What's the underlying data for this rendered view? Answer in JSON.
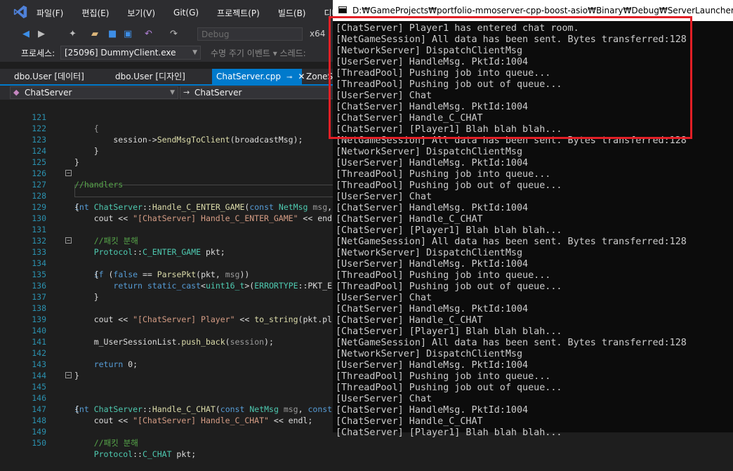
{
  "menu": {
    "items": [
      "파일(F)",
      "편집(E)",
      "보기(V)",
      "Git(G)",
      "프로젝트(P)",
      "빌드(B)",
      "디버그"
    ]
  },
  "toolbar": {
    "configuration": "Debug",
    "platform": "x64"
  },
  "process": {
    "label": "프로세스:",
    "value": "[25096] DummyClient.exe",
    "lifecycle_label": "수명 주기 이벤트 ▾ 스레드:"
  },
  "tabs": [
    {
      "label": "dbo.User [데이터]",
      "active": false
    },
    {
      "label": "dbo.User [디자인]",
      "active": false
    },
    {
      "label": "ChatServer.cpp",
      "active": true
    },
    {
      "label": "ZoneSe",
      "active": false
    }
  ],
  "nav": {
    "scope": "ChatServer",
    "member": "ChatServer"
  },
  "code_lines": [
    {
      "n": "121",
      "t": "        {"
    },
    {
      "n": "122",
      "t": "            session->SendMsgToClient(broadcastMsg);"
    },
    {
      "n": "123",
      "t": "        }"
    },
    {
      "n": "124",
      "t": "    }"
    },
    {
      "n": "125",
      "t": ""
    },
    {
      "n": "126",
      "t": "    //handlers"
    },
    {
      "n": "127",
      "t": "int ChatServer::Handle_C_ENTER_GAME(const NetMsg msg,"
    },
    {
      "n": "128",
      "t": "{"
    },
    {
      "n": "129",
      "t": "    cout << \"[ChatServer] Handle_C_ENTER_GAME\" << end"
    },
    {
      "n": "130",
      "t": ""
    },
    {
      "n": "131",
      "t": "    //패킷 분해"
    },
    {
      "n": "132",
      "t": "    Protocol::C_ENTER_GAME pkt;"
    },
    {
      "n": "133",
      "t": "    if (false == ParsePkt(pkt, msg))"
    },
    {
      "n": "134",
      "t": "    {"
    },
    {
      "n": "135",
      "t": "        return static_cast<uint16_t>(ERRORTYPE::PKT_E"
    },
    {
      "n": "136",
      "t": "    }"
    },
    {
      "n": "137",
      "t": ""
    },
    {
      "n": "138",
      "t": "    cout << \"[ChatServer] Player\" << to_string(pkt.pl"
    },
    {
      "n": "139",
      "t": ""
    },
    {
      "n": "140",
      "t": "    m_UserSessionList.push_back(session);"
    },
    {
      "n": "141",
      "t": ""
    },
    {
      "n": "142",
      "t": "    return 0;"
    },
    {
      "n": "143",
      "t": "}"
    },
    {
      "n": "144",
      "t": ""
    },
    {
      "n": "145",
      "t": "int ChatServer::Handle_C_CHAT(const NetMsg msg, const"
    },
    {
      "n": "146",
      "t": "{"
    },
    {
      "n": "147",
      "t": "    cout << \"[ChatServer] Handle_C_CHAT\" << endl;"
    },
    {
      "n": "148",
      "t": ""
    },
    {
      "n": "149",
      "t": "    //패킷 분해"
    },
    {
      "n": "150",
      "t": "    Protocol::C_CHAT pkt;"
    }
  ],
  "console": {
    "title": "D:₩GameProjects₩portfolio-mmoserver-cpp-boost-asio₩Binary₩Debug₩ServerLauncher.exe",
    "lines": [
      "[ChatServer] Player1 has entered chat room.",
      "[NetGameSession] All data has been sent. Bytes transferred:128",
      "[NetworkServer] DispatchClientMsg",
      "[UserServer] HandleMsg. PktId:1004",
      "[ThreadPool] Pushing job into queue...",
      "[ThreadPool] Pushing job out of queue...",
      "[UserServer] Chat",
      "[ChatServer] HandleMsg. PktId:1004",
      "[ChatServer] Handle_C_CHAT",
      "[ChatServer] [Player1] Blah blah blah...",
      "[NetGameSession] All data has been sent. Bytes transferred:128",
      "[NetworkServer] DispatchClientMsg",
      "[UserServer] HandleMsg. PktId:1004",
      "[ThreadPool] Pushing job into queue...",
      "[ThreadPool] Pushing job out of queue...",
      "[UserServer] Chat",
      "[ChatServer] HandleMsg. PktId:1004",
      "[ChatServer] Handle_C_CHAT",
      "[ChatServer] [Player1] Blah blah blah...",
      "[NetGameSession] All data has been sent. Bytes transferred:128",
      "[NetworkServer] DispatchClientMsg",
      "[UserServer] HandleMsg. PktId:1004",
      "[ThreadPool] Pushing job into queue...",
      "[ThreadPool] Pushing job out of queue...",
      "[UserServer] Chat",
      "[ChatServer] HandleMsg. PktId:1004",
      "[ChatServer] Handle_C_CHAT",
      "[ChatServer] [Player1] Blah blah blah...",
      "[NetGameSession] All data has been sent. Bytes transferred:128",
      "[NetworkServer] DispatchClientMsg",
      "[UserServer] HandleMsg. PktId:1004",
      "[ThreadPool] Pushing job into queue...",
      "[ThreadPool] Pushing job out of queue...",
      "[UserServer] Chat",
      "[ChatServer] HandleMsg. PktId:1004",
      "[ChatServer] Handle_C_CHAT",
      "[ChatServer] [Player1] Blah blah blah..."
    ]
  },
  "colors": {
    "accent": "#007acc",
    "highlight_box": "#e21f26"
  }
}
